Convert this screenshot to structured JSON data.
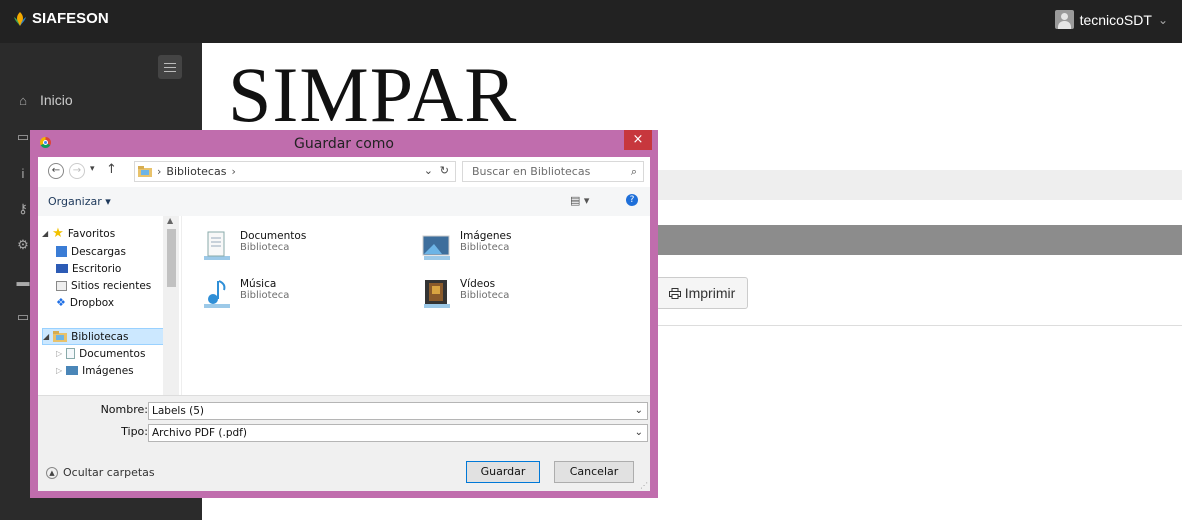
{
  "app": {
    "brand": "SIAFESON",
    "user": "tecnicoSDT",
    "user_caret": "⌄"
  },
  "sidebar": {
    "items": [
      {
        "label": "Inicio",
        "icon": "home-icon"
      }
    ]
  },
  "page": {
    "heading": "SIMPAR",
    "print_button": "Imprimir"
  },
  "dialog": {
    "title": "Guardar como",
    "close": "×",
    "address": {
      "parts": [
        "Bibliotecas"
      ]
    },
    "search_placeholder": "Buscar en Bibliotecas",
    "toolbar": {
      "organize": "Organizar ▾"
    },
    "nav": {
      "favorites": "Favoritos",
      "favorites_items": [
        "Descargas",
        "Escritorio",
        "Sitios recientes",
        "Dropbox"
      ],
      "libraries": "Bibliotecas",
      "library_items": [
        "Documentos",
        "Imágenes"
      ]
    },
    "libraries": [
      {
        "name": "Documentos",
        "type": "Biblioteca"
      },
      {
        "name": "Imágenes",
        "type": "Biblioteca"
      },
      {
        "name": "Música",
        "type": "Biblioteca"
      },
      {
        "name": "Vídeos",
        "type": "Biblioteca"
      }
    ],
    "filename_label": "Nombre:",
    "filename_value": "Labels (5)",
    "type_label": "Tipo:",
    "type_value": "Archivo PDF (.pdf)",
    "hide_folders": "Ocultar carpetas",
    "save_button": "Guardar",
    "cancel_button": "Cancelar"
  }
}
